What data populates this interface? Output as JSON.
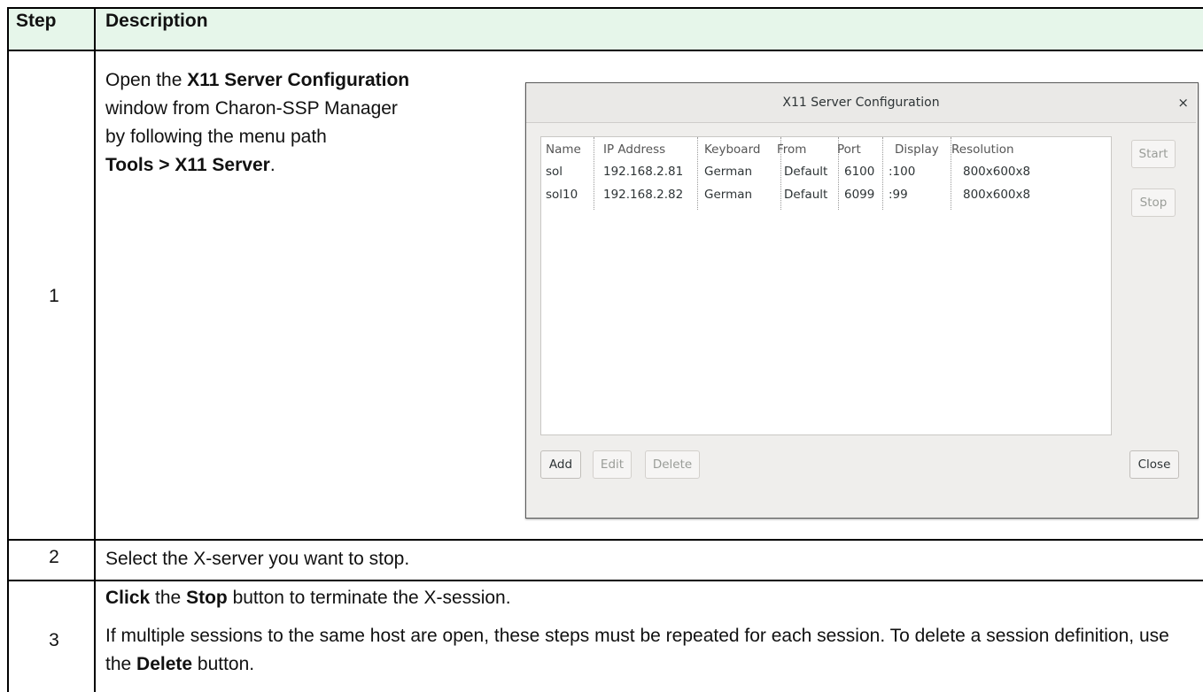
{
  "table": {
    "header": {
      "step": "Step",
      "description": "Description"
    },
    "rows": [
      {
        "step": "1",
        "text_parts": [
          "Open the ",
          "X11 Server Configuration",
          " window from Charon-SSP Manager by following the menu path ",
          "Tools > X11 Server",
          "."
        ]
      },
      {
        "step": "2",
        "text": "Select the X-server you want to stop."
      },
      {
        "step": "3",
        "line1_parts": [
          "Click",
          " the ",
          "Stop",
          " button to terminate the X-session."
        ],
        "line2_parts": [
          "If multiple sessions to the same host are open, these steps must be repeated for each session. To delete a session definition, use the ",
          "Delete",
          " button."
        ]
      }
    ]
  },
  "dialog": {
    "title": "X11 Server Configuration",
    "close_icon": "×",
    "columns": [
      "Name",
      "IP Address",
      "Keyboard",
      "From",
      "Port",
      "Display",
      "Resolution"
    ],
    "entries": [
      [
        "sol",
        "192.168.2.81",
        "German",
        "Default",
        "6100",
        ":100",
        "800x600x8"
      ],
      [
        "sol10",
        "192.168.2.82",
        "German",
        "Default",
        "6099",
        ":99",
        "800x600x8"
      ]
    ],
    "buttons": {
      "start": "Start",
      "stop": "Stop",
      "add": "Add",
      "edit": "Edit",
      "delete": "Delete",
      "close": "Close"
    }
  },
  "colors": {
    "header_bg": "#e6f6ea",
    "grid": "#000000"
  }
}
